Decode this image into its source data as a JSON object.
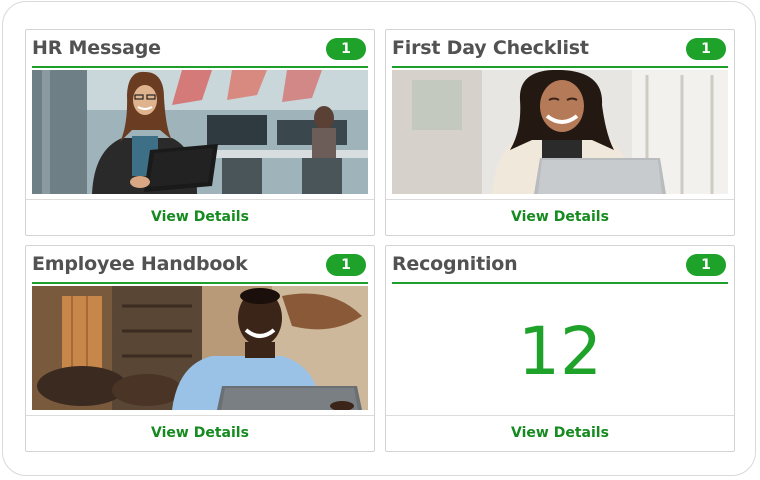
{
  "cards": [
    {
      "title": "HR Message",
      "badge": "1",
      "link": "View Details",
      "photo": "woman-with-tablet-in-office"
    },
    {
      "title": "First Day Checklist",
      "badge": "1",
      "link": "View Details",
      "photo": "woman-smiling-at-laptop"
    },
    {
      "title": "Employee Handbook",
      "badge": "1",
      "link": "View Details",
      "photo": "man-smiling-at-laptop"
    },
    {
      "title": "Recognition",
      "badge": "1",
      "link": "View Details",
      "value": "12"
    }
  ],
  "colors": {
    "accent": "#1ea22a",
    "link": "#158a1f",
    "title": "#525252",
    "border": "#d4d4d4"
  }
}
